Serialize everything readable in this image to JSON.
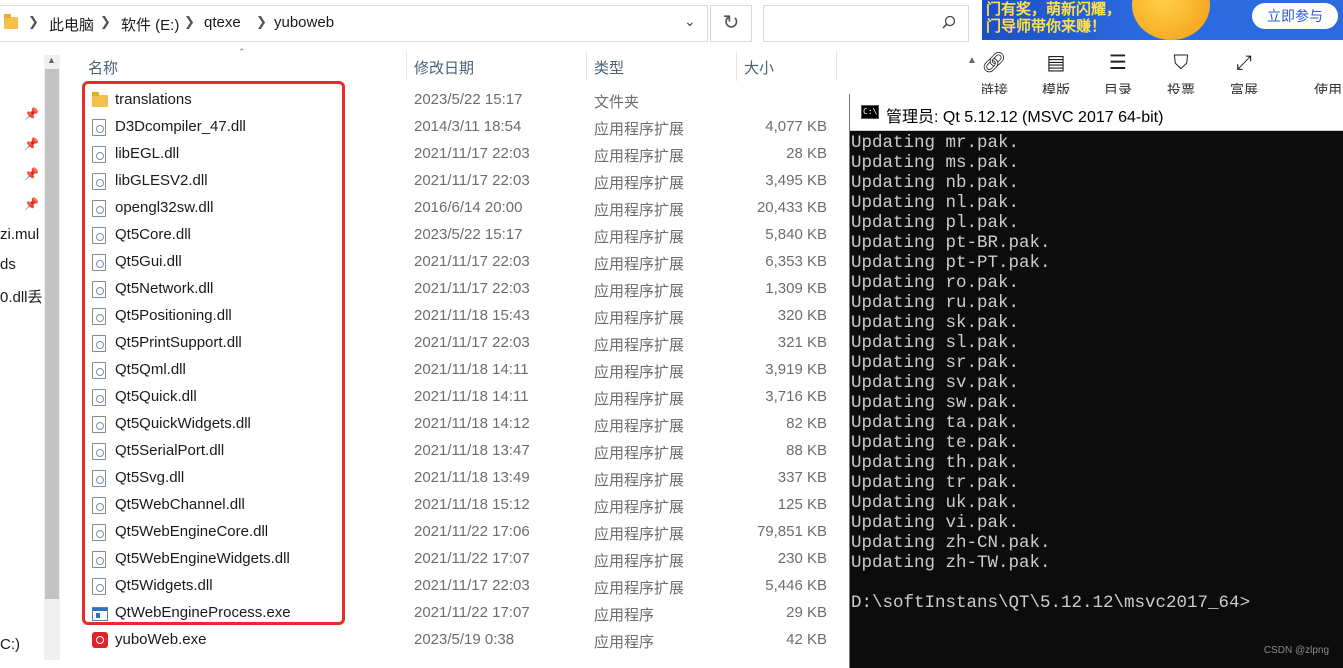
{
  "explorer": {
    "breadcrumb": [
      "此电脑",
      "软件 (E:)",
      "qtexe",
      "yuboweb"
    ],
    "search_placeholder": "",
    "columns": {
      "name": "名称",
      "date": "修改日期",
      "type": "类型",
      "size": "大小"
    },
    "nav_labels": [
      "zi.mul",
      "ds",
      "0.dll丢",
      "C:)"
    ],
    "files": [
      {
        "name": "translations",
        "date": "2023/5/22 15:17",
        "type": "文件夹",
        "size": "",
        "icon": "folder-icon"
      },
      {
        "name": "D3Dcompiler_47.dll",
        "date": "2014/3/11 18:54",
        "type": "应用程序扩展",
        "size": "4,077 KB",
        "icon": "dll-file-icon"
      },
      {
        "name": "libEGL.dll",
        "date": "2021/11/17 22:03",
        "type": "应用程序扩展",
        "size": "28 KB",
        "icon": "dll-file-icon"
      },
      {
        "name": "libGLESV2.dll",
        "date": "2021/11/17 22:03",
        "type": "应用程序扩展",
        "size": "3,495 KB",
        "icon": "dll-file-icon"
      },
      {
        "name": "opengl32sw.dll",
        "date": "2016/6/14 20:00",
        "type": "应用程序扩展",
        "size": "20,433 KB",
        "icon": "dll-file-icon"
      },
      {
        "name": "Qt5Core.dll",
        "date": "2023/5/22 15:17",
        "type": "应用程序扩展",
        "size": "5,840 KB",
        "icon": "dll-file-icon"
      },
      {
        "name": "Qt5Gui.dll",
        "date": "2021/11/17 22:03",
        "type": "应用程序扩展",
        "size": "6,353 KB",
        "icon": "dll-file-icon"
      },
      {
        "name": "Qt5Network.dll",
        "date": "2021/11/17 22:03",
        "type": "应用程序扩展",
        "size": "1,309 KB",
        "icon": "dll-file-icon"
      },
      {
        "name": "Qt5Positioning.dll",
        "date": "2021/11/18 15:43",
        "type": "应用程序扩展",
        "size": "320 KB",
        "icon": "dll-file-icon"
      },
      {
        "name": "Qt5PrintSupport.dll",
        "date": "2021/11/17 22:03",
        "type": "应用程序扩展",
        "size": "321 KB",
        "icon": "dll-file-icon"
      },
      {
        "name": "Qt5Qml.dll",
        "date": "2021/11/18 14:11",
        "type": "应用程序扩展",
        "size": "3,919 KB",
        "icon": "dll-file-icon"
      },
      {
        "name": "Qt5Quick.dll",
        "date": "2021/11/18 14:11",
        "type": "应用程序扩展",
        "size": "3,716 KB",
        "icon": "dll-file-icon"
      },
      {
        "name": "Qt5QuickWidgets.dll",
        "date": "2021/11/18 14:12",
        "type": "应用程序扩展",
        "size": "82 KB",
        "icon": "dll-file-icon"
      },
      {
        "name": "Qt5SerialPort.dll",
        "date": "2021/11/18 13:47",
        "type": "应用程序扩展",
        "size": "88 KB",
        "icon": "dll-file-icon"
      },
      {
        "name": "Qt5Svg.dll",
        "date": "2021/11/18 13:49",
        "type": "应用程序扩展",
        "size": "337 KB",
        "icon": "dll-file-icon"
      },
      {
        "name": "Qt5WebChannel.dll",
        "date": "2021/11/18 15:12",
        "type": "应用程序扩展",
        "size": "125 KB",
        "icon": "dll-file-icon"
      },
      {
        "name": "Qt5WebEngineCore.dll",
        "date": "2021/11/22 17:06",
        "type": "应用程序扩展",
        "size": "79,851 KB",
        "icon": "dll-file-icon"
      },
      {
        "name": "Qt5WebEngineWidgets.dll",
        "date": "2021/11/22 17:07",
        "type": "应用程序扩展",
        "size": "230 KB",
        "icon": "dll-file-icon"
      },
      {
        "name": "Qt5Widgets.dll",
        "date": "2021/11/17 22:03",
        "type": "应用程序扩展",
        "size": "5,446 KB",
        "icon": "dll-file-icon"
      },
      {
        "name": "QtWebEngineProcess.exe",
        "date": "2021/11/22 17:07",
        "type": "应用程序",
        "size": "29 KB",
        "icon": "exe-file-icon"
      },
      {
        "name": "yuboWeb.exe",
        "date": "2023/5/19 0:38",
        "type": "应用程序",
        "size": "42 KB",
        "icon": "app-exe-icon"
      }
    ]
  },
  "web_page": {
    "banner_line1": "门有奖，萌新闪耀，",
    "banner_line2": "门导师带你来赚！",
    "join_button": "立即参与",
    "toolbar": [
      {
        "label": "链接",
        "icon": "link-icon"
      },
      {
        "label": "模版",
        "icon": "template-icon"
      },
      {
        "label": "目录",
        "icon": "toc-icon"
      },
      {
        "label": "投票",
        "icon": "vote-icon"
      },
      {
        "label": "富展",
        "icon": "expand-icon"
      },
      {
        "label": "使用",
        "icon": ""
      }
    ]
  },
  "console": {
    "title": "管理员: Qt 5.12.12 (MSVC 2017 64-bit)",
    "icon_text": "C:\\",
    "lines": [
      "Updating mr.pak.",
      "Updating ms.pak.",
      "Updating nb.pak.",
      "Updating nl.pak.",
      "Updating pl.pak.",
      "Updating pt-BR.pak.",
      "Updating pt-PT.pak.",
      "Updating ro.pak.",
      "Updating ru.pak.",
      "Updating sk.pak.",
      "Updating sl.pak.",
      "Updating sr.pak.",
      "Updating sv.pak.",
      "Updating sw.pak.",
      "Updating ta.pak.",
      "Updating te.pak.",
      "Updating th.pak.",
      "Updating tr.pak.",
      "Updating uk.pak.",
      "Updating vi.pak.",
      "Updating zh-CN.pak.",
      "Updating zh-TW.pak.",
      "",
      "D:\\softInstans\\QT\\5.12.12\\msvc2017_64>"
    ]
  },
  "watermark": "CSDN @zlpng",
  "colors": {
    "highlight_box": "#ea2b2b",
    "console_bg": "#0c0c0c",
    "console_text": "#cccccc",
    "header_text": "#4c607a"
  }
}
